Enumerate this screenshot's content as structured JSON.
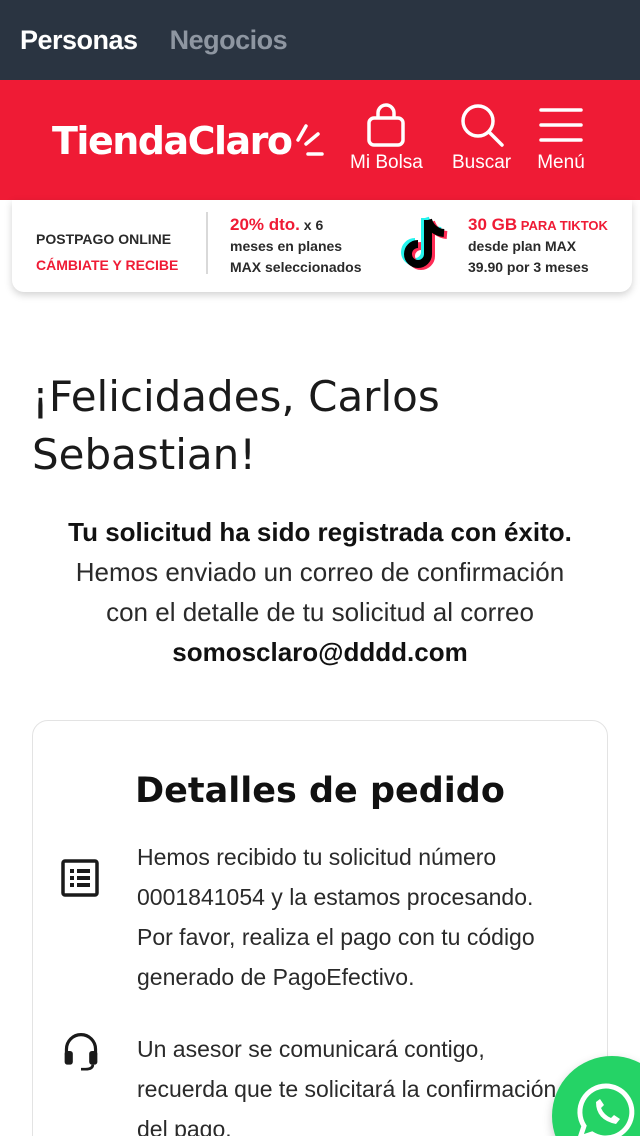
{
  "segments": [
    {
      "label": "Personas",
      "active": true
    },
    {
      "label": "Negocios",
      "active": false
    }
  ],
  "header": {
    "logo_text": "TiendaClaro",
    "bag_label": "Mi Bolsa",
    "search_label": "Buscar",
    "menu_label": "Menú",
    "bg_color": "#ef1b35"
  },
  "promo": {
    "left_line1": "POSTPAGO ONLINE",
    "left_line2": "CÁMBIATE Y RECIBE",
    "mid_highlight": "20% dto.",
    "mid_rest1": " x 6",
    "mid_line2": "meses en planes",
    "mid_line3": "MAX seleccionados",
    "right_highlight": "30 GB",
    "right_highlight_small": " PARA TIKTOK",
    "right_line2": "desde plan MAX",
    "right_line3": "39.90 por 3 meses"
  },
  "confirmation": {
    "heading_line1": "¡Felicidades, Carlos",
    "heading_line2": "Sebastian!",
    "success_text": "Tu solicitud ha sido registrada con éxito.",
    "info_line1": "Hemos enviado un correo de confirmación",
    "info_line2": "con el detalle de tu solicitud al correo",
    "email": "somosclaro@dddd.com"
  },
  "details": {
    "title": "Detalles de pedido",
    "items": [
      {
        "icon": "list-icon",
        "lines": [
          "Hemos recibido tu solicitud número",
          "0001841054 y la estamos procesando.",
          "Por favor, realiza el pago con tu código",
          "generado de PagoEfectivo."
        ]
      },
      {
        "icon": "headset-icon",
        "lines": [
          "Un asesor se comunicará contigo,",
          "recuerda que te solicitará la confirmación",
          "del pago."
        ]
      }
    ]
  },
  "fab": {
    "icon": "whatsapp-icon",
    "color": "#25d366"
  }
}
